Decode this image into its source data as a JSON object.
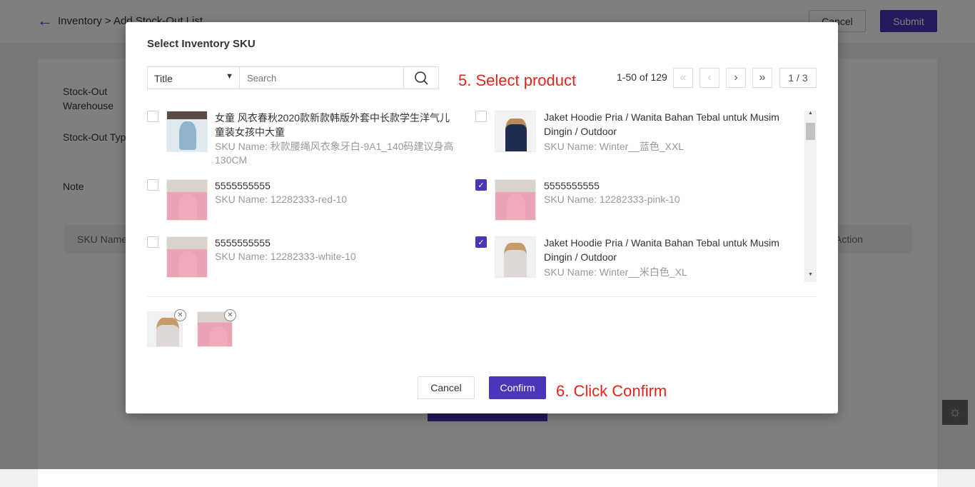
{
  "page": {
    "breadcrumb": "Inventory > Add Stock-Out List",
    "cancel": "Cancel",
    "submit": "Submit",
    "labels": [
      "Stock-Out Warehouse",
      "Stock-Out Type",
      "Note"
    ],
    "table_headers": [
      "SKU Name",
      "Action"
    ]
  },
  "modal": {
    "title": "Select Inventory SKU",
    "filter_select": "Title",
    "search_placeholder": "Search",
    "pagination": {
      "range": "1-50 of 129",
      "page": "1 / 3"
    },
    "annotation_select": "5. Select product",
    "annotation_confirm": "6. Click Confirm",
    "items": [
      {
        "title": "女童 风衣春秋2020款新款韩版外套中长款学生洋气儿童装女孩中大童",
        "sku": "SKU Name: 秋款腰绳风衣象牙白-9A1_140码建议身高130CM",
        "checked": false,
        "image": "kid"
      },
      {
        "title": "Jaket Hoodie Pria / Wanita Bahan Tebal untuk Musim Dingin / Outdoor",
        "sku": "SKU Name: Winter__蓝色_XXL",
        "checked": false,
        "image": "navy"
      },
      {
        "title": "5555555555",
        "sku": "SKU Name: 12282333-red-10",
        "checked": false,
        "image": "dress"
      },
      {
        "title": "5555555555",
        "sku": "SKU Name: 12282333-pink-10",
        "checked": true,
        "image": "dress"
      },
      {
        "title": "5555555555",
        "sku": "SKU Name: 12282333-white-10",
        "checked": false,
        "image": "dress"
      },
      {
        "title": "Jaket Hoodie Pria / Wanita Bahan Tebal untuk Musim Dingin / Outdoor",
        "sku": "SKU Name: Winter__米白色_XL",
        "checked": true,
        "image": "white"
      }
    ],
    "cancel": "Cancel",
    "confirm": "Confirm"
  },
  "colors": {
    "accent": "#4b35b8",
    "annotation": "#e8221c"
  }
}
